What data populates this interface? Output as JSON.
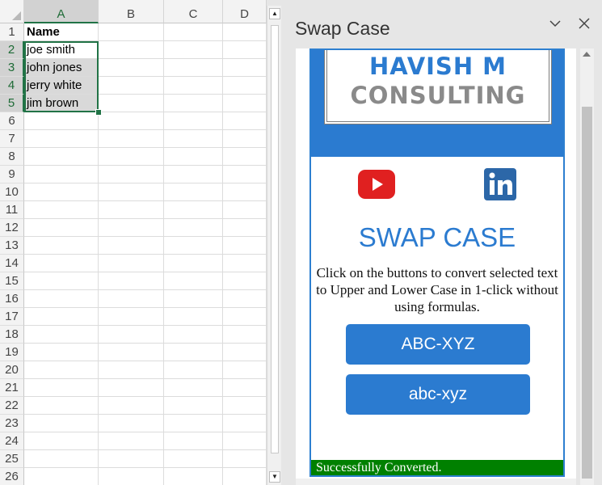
{
  "sheet": {
    "columns": [
      "A",
      "B",
      "C",
      "D"
    ],
    "rows": [
      "1",
      "2",
      "3",
      "4",
      "5",
      "6",
      "7",
      "8",
      "9",
      "10",
      "11",
      "12",
      "13",
      "14",
      "15",
      "16",
      "17",
      "18",
      "19",
      "20",
      "21",
      "22",
      "23",
      "24",
      "25",
      "26"
    ],
    "cells": {
      "A1": "Name",
      "A2": "joe smith",
      "A3": "john jones",
      "A4": "jerry white",
      "A5": "jim brown"
    },
    "selected_range": "A2:A5",
    "accent_color": "#217346"
  },
  "pane": {
    "title": "Swap Case",
    "chevron_icon": "chevron-down-icon",
    "close_icon": "close-icon",
    "logo_line1": "HAVISH M",
    "logo_line2": "CONSULTING",
    "youtube_icon": "youtube-icon",
    "linkedin_icon": "linkedin-icon",
    "heading": "SWAP CASE",
    "description": "Click on the buttons to convert selected text to Upper and Lower Case in 1-click without using formulas.",
    "upper_button": "ABC-XYZ",
    "lower_button": "abc-xyz",
    "status": "Successfully Converted.",
    "brand_color": "#2b7bd0",
    "status_color": "#008000"
  }
}
